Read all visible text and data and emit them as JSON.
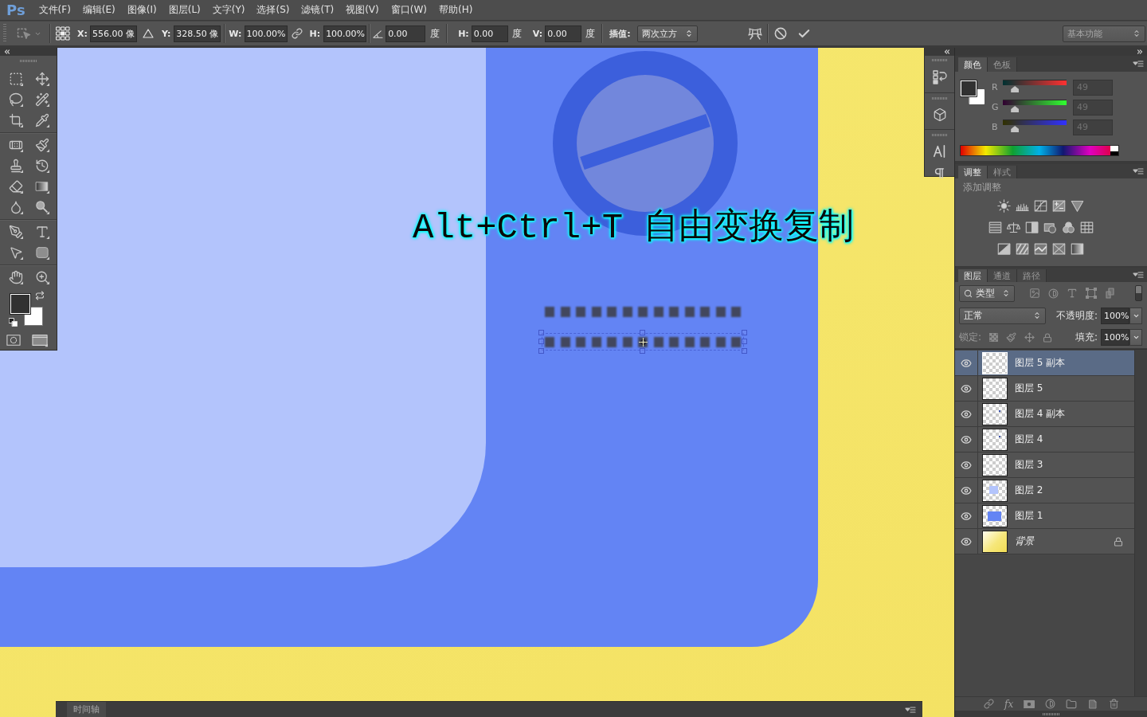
{
  "app": {
    "logo": "Ps"
  },
  "menu": [
    "文件(F)",
    "编辑(E)",
    "图像(I)",
    "图层(L)",
    "文字(Y)",
    "选择(S)",
    "滤镜(T)",
    "视图(V)",
    "窗口(W)",
    "帮助(H)"
  ],
  "options_bar": {
    "position": [
      {
        "label": "X:",
        "value": "556.00 像"
      },
      {
        "label": "Y:",
        "value": "328.50 像"
      }
    ],
    "size": [
      {
        "label": "W:",
        "value": "100.00%"
      },
      {
        "label": "H:",
        "value": "100.00%"
      }
    ],
    "rotation": {
      "value": "0.00",
      "unit": "度"
    },
    "skew": [
      {
        "label": "H:",
        "value": "0.00",
        "unit": "度"
      },
      {
        "label": "V:",
        "value": "0.00",
        "unit": "度"
      }
    ],
    "interpolation": {
      "label": "插值:",
      "value": "两次立方"
    },
    "workspace": "基本功能"
  },
  "canvas": {
    "caption": "Alt+Ctrl+T 自由变换复制"
  },
  "color_panel": {
    "tabs": [
      {
        "label": "颜色",
        "selected": true
      },
      {
        "label": "色板",
        "selected": false
      }
    ],
    "channels": [
      {
        "name": "R",
        "value": "49",
        "level": 0.19,
        "disabled": true
      },
      {
        "name": "G",
        "value": "49",
        "level": 0.19,
        "disabled": true
      },
      {
        "name": "B",
        "value": "49",
        "level": 0.19,
        "disabled": true
      }
    ]
  },
  "adjustments_panel": {
    "tabs": [
      {
        "label": "调整",
        "selected": true
      },
      {
        "label": "样式",
        "selected": false
      }
    ],
    "heading": "添加调整"
  },
  "layers_panel": {
    "tabs": [
      {
        "label": "图层",
        "selected": true
      },
      {
        "label": "通道",
        "selected": false
      },
      {
        "label": "路径",
        "selected": false
      }
    ],
    "filter": "类型",
    "filter_switch": {
      "on": true
    },
    "blend_mode": "正常",
    "opacity": {
      "label": "不透明度:",
      "value": "100%"
    },
    "lock_label": "锁定:",
    "fill": {
      "label": "填充:",
      "value": "100%"
    },
    "layers": [
      {
        "name": "图层 5 副本",
        "kind": "transparent",
        "visible": true,
        "selected": true,
        "locked": false
      },
      {
        "name": "图层 5",
        "kind": "transparent",
        "visible": true,
        "selected": false,
        "locked": false
      },
      {
        "name": "图层 4 副本",
        "kind": "dot",
        "visible": true,
        "selected": false,
        "locked": false
      },
      {
        "name": "图层 4",
        "kind": "dot",
        "visible": true,
        "selected": false,
        "locked": false
      },
      {
        "name": "图层 3",
        "kind": "transparent",
        "visible": true,
        "selected": false,
        "locked": false
      },
      {
        "name": "图层 2",
        "kind": "light-rect",
        "visible": true,
        "selected": false,
        "locked": false
      },
      {
        "name": "图层 1",
        "kind": "rect",
        "visible": true,
        "selected": false,
        "locked": false
      },
      {
        "name": "背景",
        "kind": "background",
        "visible": true,
        "selected": false,
        "locked": true
      }
    ],
    "footer": {
      "effects": "fx"
    }
  },
  "timeline": {
    "title": "时间轴"
  }
}
